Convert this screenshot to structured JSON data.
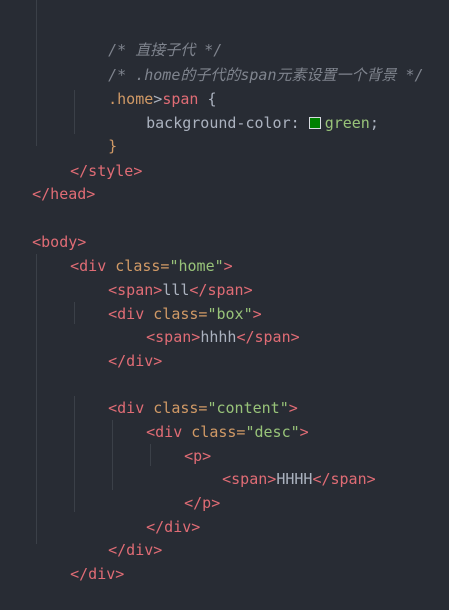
{
  "colors": {
    "swatch_green": "#008000"
  },
  "code": {
    "comment1": "/* 直接子代 */",
    "comment2": "/* .home的子代的span元素设置一个背景 */",
    "selector_class": ".home",
    "selector_combinator": ">",
    "selector_tag": "span",
    "brace_open": " {",
    "prop": "background-color: ",
    "value": "green",
    "semicolon": ";",
    "brace_close": "}",
    "style_close": "</style>",
    "head_close": "</head>",
    "body_open": "<body>",
    "div_home": {
      "open": "<div",
      "attr": " class=",
      "val": "\"home\"",
      "end": ">"
    },
    "span_lll": {
      "open": "<span>",
      "text": "lll",
      "close": "</span>"
    },
    "div_box": {
      "open": "<div",
      "attr": " class=",
      "val": "\"box\"",
      "end": ">"
    },
    "span_hhhh": {
      "open": "<span>",
      "text": "hhhh",
      "close": "</span>"
    },
    "div_close": "</div>",
    "div_content": {
      "open": "<div",
      "attr": " class=",
      "val": "\"content\"",
      "end": ">"
    },
    "div_desc": {
      "open": "<div",
      "attr": " class=",
      "val": "\"desc\"",
      "end": ">"
    },
    "p_open": "<p>",
    "span_HHHH": {
      "open": "<span>",
      "text": "HHHH",
      "close": "</span>"
    },
    "p_close": "</p>"
  }
}
